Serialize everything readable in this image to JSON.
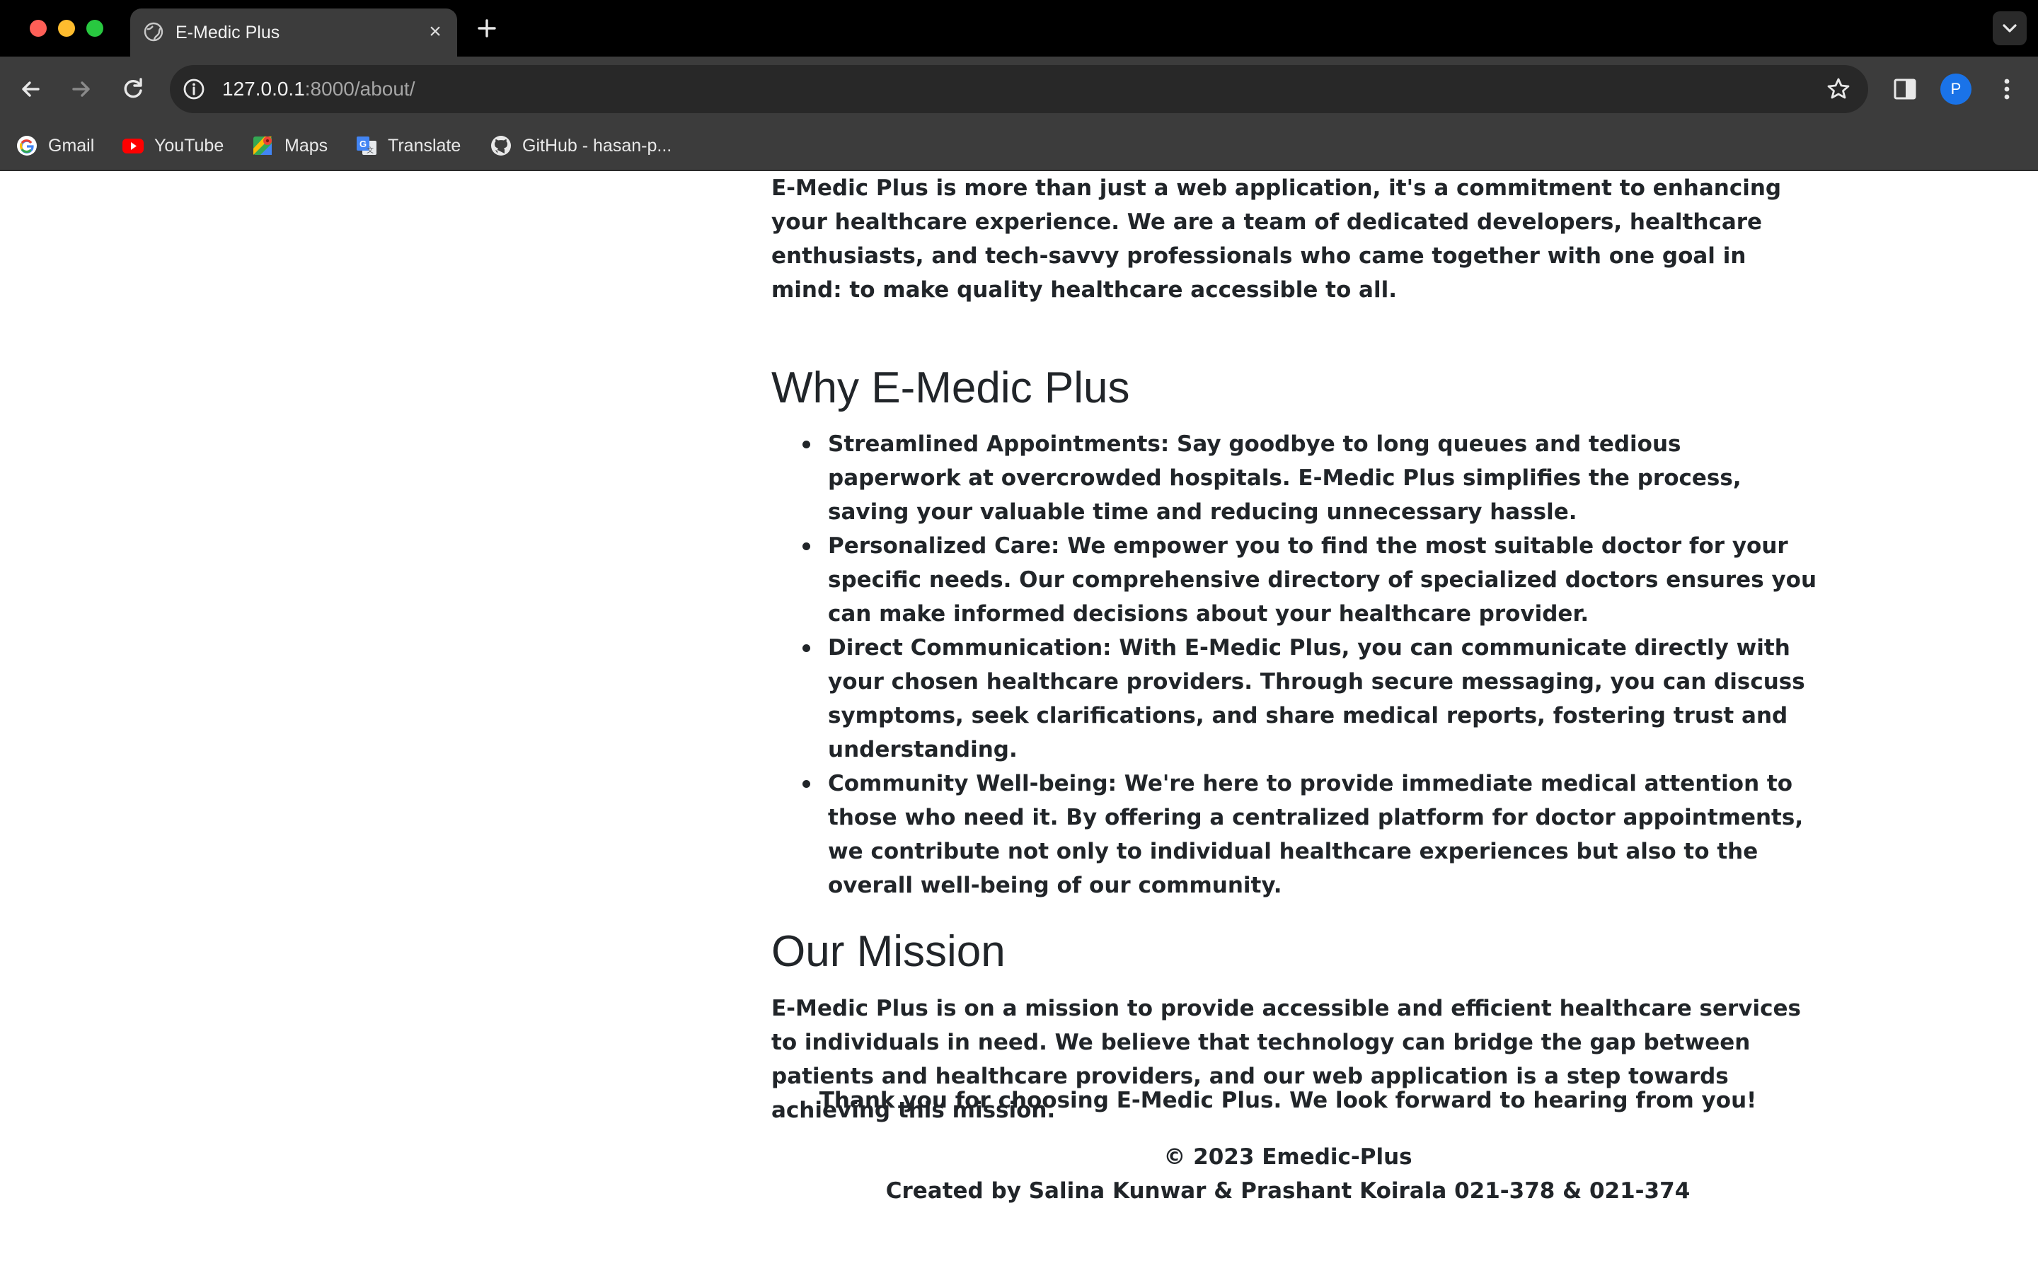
{
  "browser": {
    "tab_title": "E-Medic Plus",
    "tab_close_glyph": "×",
    "url_host": "127.0.0.1",
    "url_path": ":8000/about/",
    "profile_initial": "P",
    "bookmarks": [
      {
        "label": "Gmail",
        "icon": "google-icon"
      },
      {
        "label": "YouTube",
        "icon": "youtube-icon"
      },
      {
        "label": "Maps",
        "icon": "maps-icon"
      },
      {
        "label": "Translate",
        "icon": "translate-icon"
      },
      {
        "label": "GitHub - hasan-p...",
        "icon": "github-icon"
      }
    ],
    "colors": {
      "tab_strip": "#000000",
      "toolbar": "#3c3c3c",
      "omnibox": "#282828",
      "avatar": "#1a73e8",
      "close": "#fe5f57",
      "minimize": "#febc2e",
      "maximize": "#28c840"
    }
  },
  "page": {
    "intro": "E-Medic Plus is more than just a web application, it's a commitment to enhancing your healthcare experience. We are a team of dedicated developers, healthcare enthusiasts, and tech-savvy professionals who came together with one goal in mind: to make quality healthcare accessible to all.",
    "why_heading": "Why E-Medic Plus",
    "why_items": [
      {
        "title": "Streamlined Appointments:",
        "text": " Say goodbye to long queues and tedious paperwork at overcrowded hospitals. E-Medic Plus simplifies the process, saving your valuable time and reducing unnecessary hassle."
      },
      {
        "title": "Personalized Care:",
        "text": " We empower you to find the most suitable doctor for your specific needs. Our comprehensive directory of specialized doctors ensures you can make informed decisions about your healthcare provider."
      },
      {
        "title": "Direct Communication:",
        "text": " With E-Medic Plus, you can communicate directly with your chosen healthcare providers. Through secure messaging, you can discuss symptoms, seek clarifications, and share medical reports, fostering trust and understanding."
      },
      {
        "title": "Community Well-being:",
        "text": " We're here to provide immediate medical attention to those who need it. By offering a centralized platform for doctor appointments, we contribute not only to individual healthcare experiences but also to the overall well-being of our community."
      }
    ],
    "mission_heading": "Our Mission",
    "mission_text": "E-Medic Plus is on a mission to provide accessible and efficient healthcare services to individuals in need. We believe that technology can bridge the gap between patients and healthcare providers, and our web application is a step towards achieving this mission.",
    "thanks": "Thank you for choosing E-Medic Plus. We look forward to hearing from you!",
    "copyright": "© 2023 Emedic-Plus",
    "credits": "Created by Salina Kunwar & Prashant Koirala 021-378 & 021-374"
  }
}
